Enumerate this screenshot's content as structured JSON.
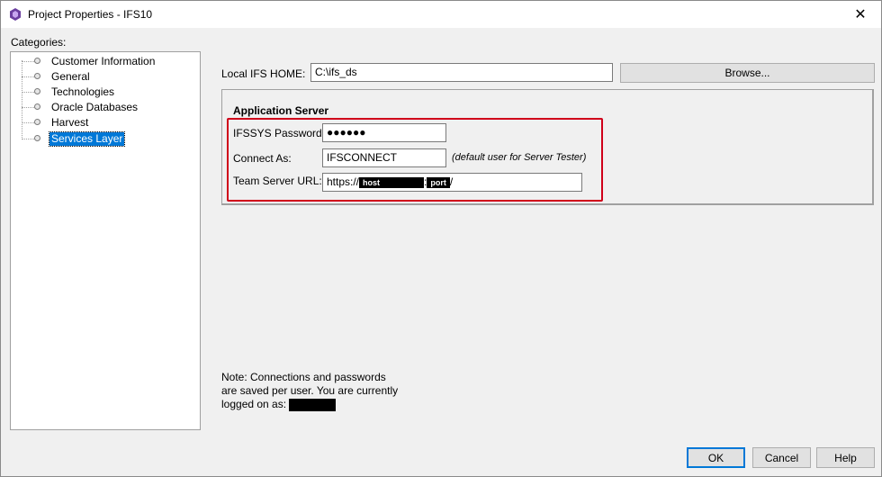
{
  "window": {
    "title": "Project Properties - IFS10",
    "close_glyph": "✕"
  },
  "categories": {
    "label": "Categories:",
    "items": [
      {
        "label": "Customer Information",
        "selected": false
      },
      {
        "label": "General",
        "selected": false
      },
      {
        "label": "Technologies",
        "selected": false
      },
      {
        "label": "Oracle Databases",
        "selected": false
      },
      {
        "label": "Harvest",
        "selected": false
      },
      {
        "label": "Services Layer",
        "selected": true
      }
    ]
  },
  "local_home": {
    "label": "Local IFS HOME:",
    "value": "C:\\ifs_ds",
    "browse_label": "Browse..."
  },
  "app_server": {
    "title": "Application Server",
    "password_label": "IFSSYS Password:",
    "password_value": "●●●●●●",
    "connect_label": "Connect As:",
    "connect_value": "IFSCONNECT",
    "connect_hint": "(default user for Server Tester)",
    "url_label": "Team Server URL:",
    "url_prefix": "https://",
    "url_host": "host",
    "url_sep": ":",
    "url_port": "port",
    "url_suffix": "/"
  },
  "note": {
    "text": "Note: Connections and passwords are saved per user. You are currently logged on as:"
  },
  "buttons": {
    "ok": "OK",
    "cancel": "Cancel",
    "help": "Help"
  },
  "colors": {
    "selection": "#0078d7",
    "highlight_border": "#d0001a",
    "app_icon": "#6b3fa0"
  },
  "icons": {
    "app": "ifs-app-icon",
    "close": "close-icon"
  }
}
